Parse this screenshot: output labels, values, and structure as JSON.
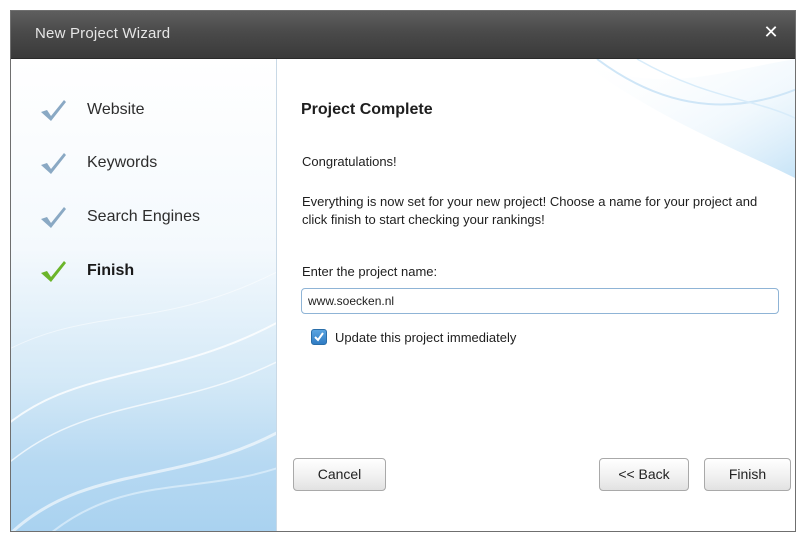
{
  "window": {
    "title": "New Project Wizard",
    "close_glyph": "✕"
  },
  "steps": [
    {
      "label": "Website",
      "status": "done",
      "icon": "check-icon",
      "color": "#8aa9c4"
    },
    {
      "label": "Keywords",
      "status": "done",
      "icon": "check-icon",
      "color": "#8aa9c4"
    },
    {
      "label": "Search Engines",
      "status": "done",
      "icon": "check-icon",
      "color": "#8aa9c4"
    },
    {
      "label": "Finish",
      "status": "current",
      "icon": "check-icon",
      "color": "#6bb52a"
    }
  ],
  "main": {
    "heading": "Project Complete",
    "congrats": "Congratulations!",
    "description": "Everything is now set for your new project! Choose a name for your project and click finish to start checking your rankings!",
    "name_label": "Enter the project name:",
    "name_value": "www.soecken.nl",
    "update_checkbox": {
      "label": "Update this project immediately",
      "checked": true
    }
  },
  "buttons": {
    "cancel": "Cancel",
    "back": "<< Back",
    "finish": "Finish"
  },
  "colors": {
    "titlebar": "#4a4a4a",
    "accent_blue": "#2f7cc4",
    "check_done": "#8aa9c4",
    "check_current": "#6bb52a"
  }
}
